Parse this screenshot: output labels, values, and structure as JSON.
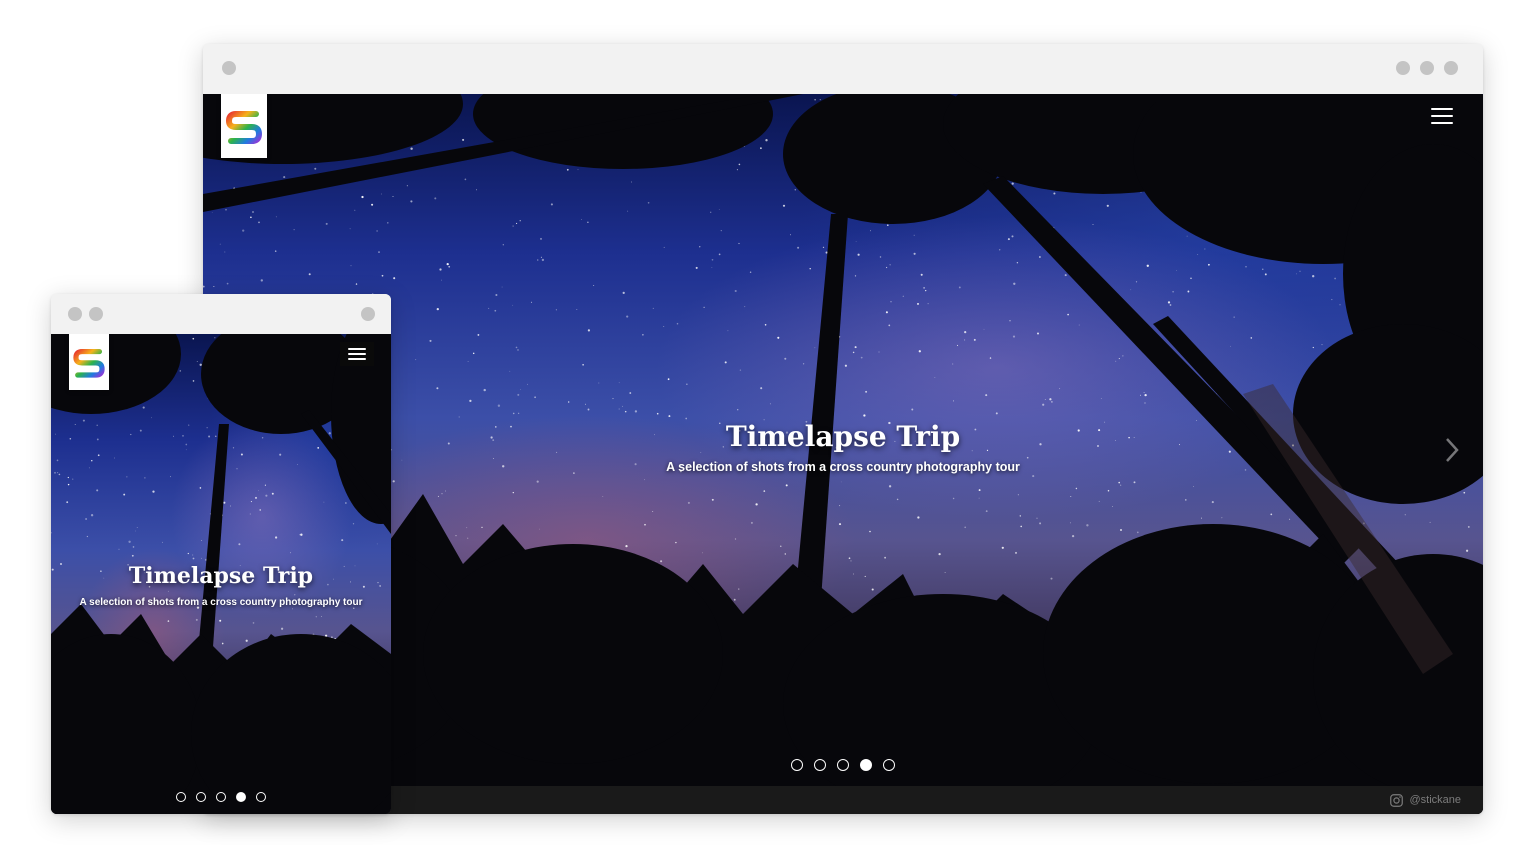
{
  "desktop": {
    "hero": {
      "title": "Timelapse Trip",
      "subtitle": "A selection of shots from a cross country photography tour"
    },
    "carousel": {
      "slide_count": 5,
      "active_index": 3
    },
    "footer": {
      "instagram_handle": "@stickane",
      "icon": "instagram-icon"
    },
    "menu_icon": "hamburger-menu-icon",
    "next_icon": "chevron-right-icon"
  },
  "mobile": {
    "hero": {
      "title": "Timelapse Trip",
      "subtitle": "A selection of shots from a cross country photography tour"
    },
    "carousel": {
      "slide_count": 5,
      "active_index": 3
    },
    "menu_icon": "hamburger-menu-icon"
  },
  "colors": {
    "footer_bg": "#1a1a1a",
    "window_chrome": "#f2f2f2",
    "chrome_dot": "#c4c4c4"
  }
}
